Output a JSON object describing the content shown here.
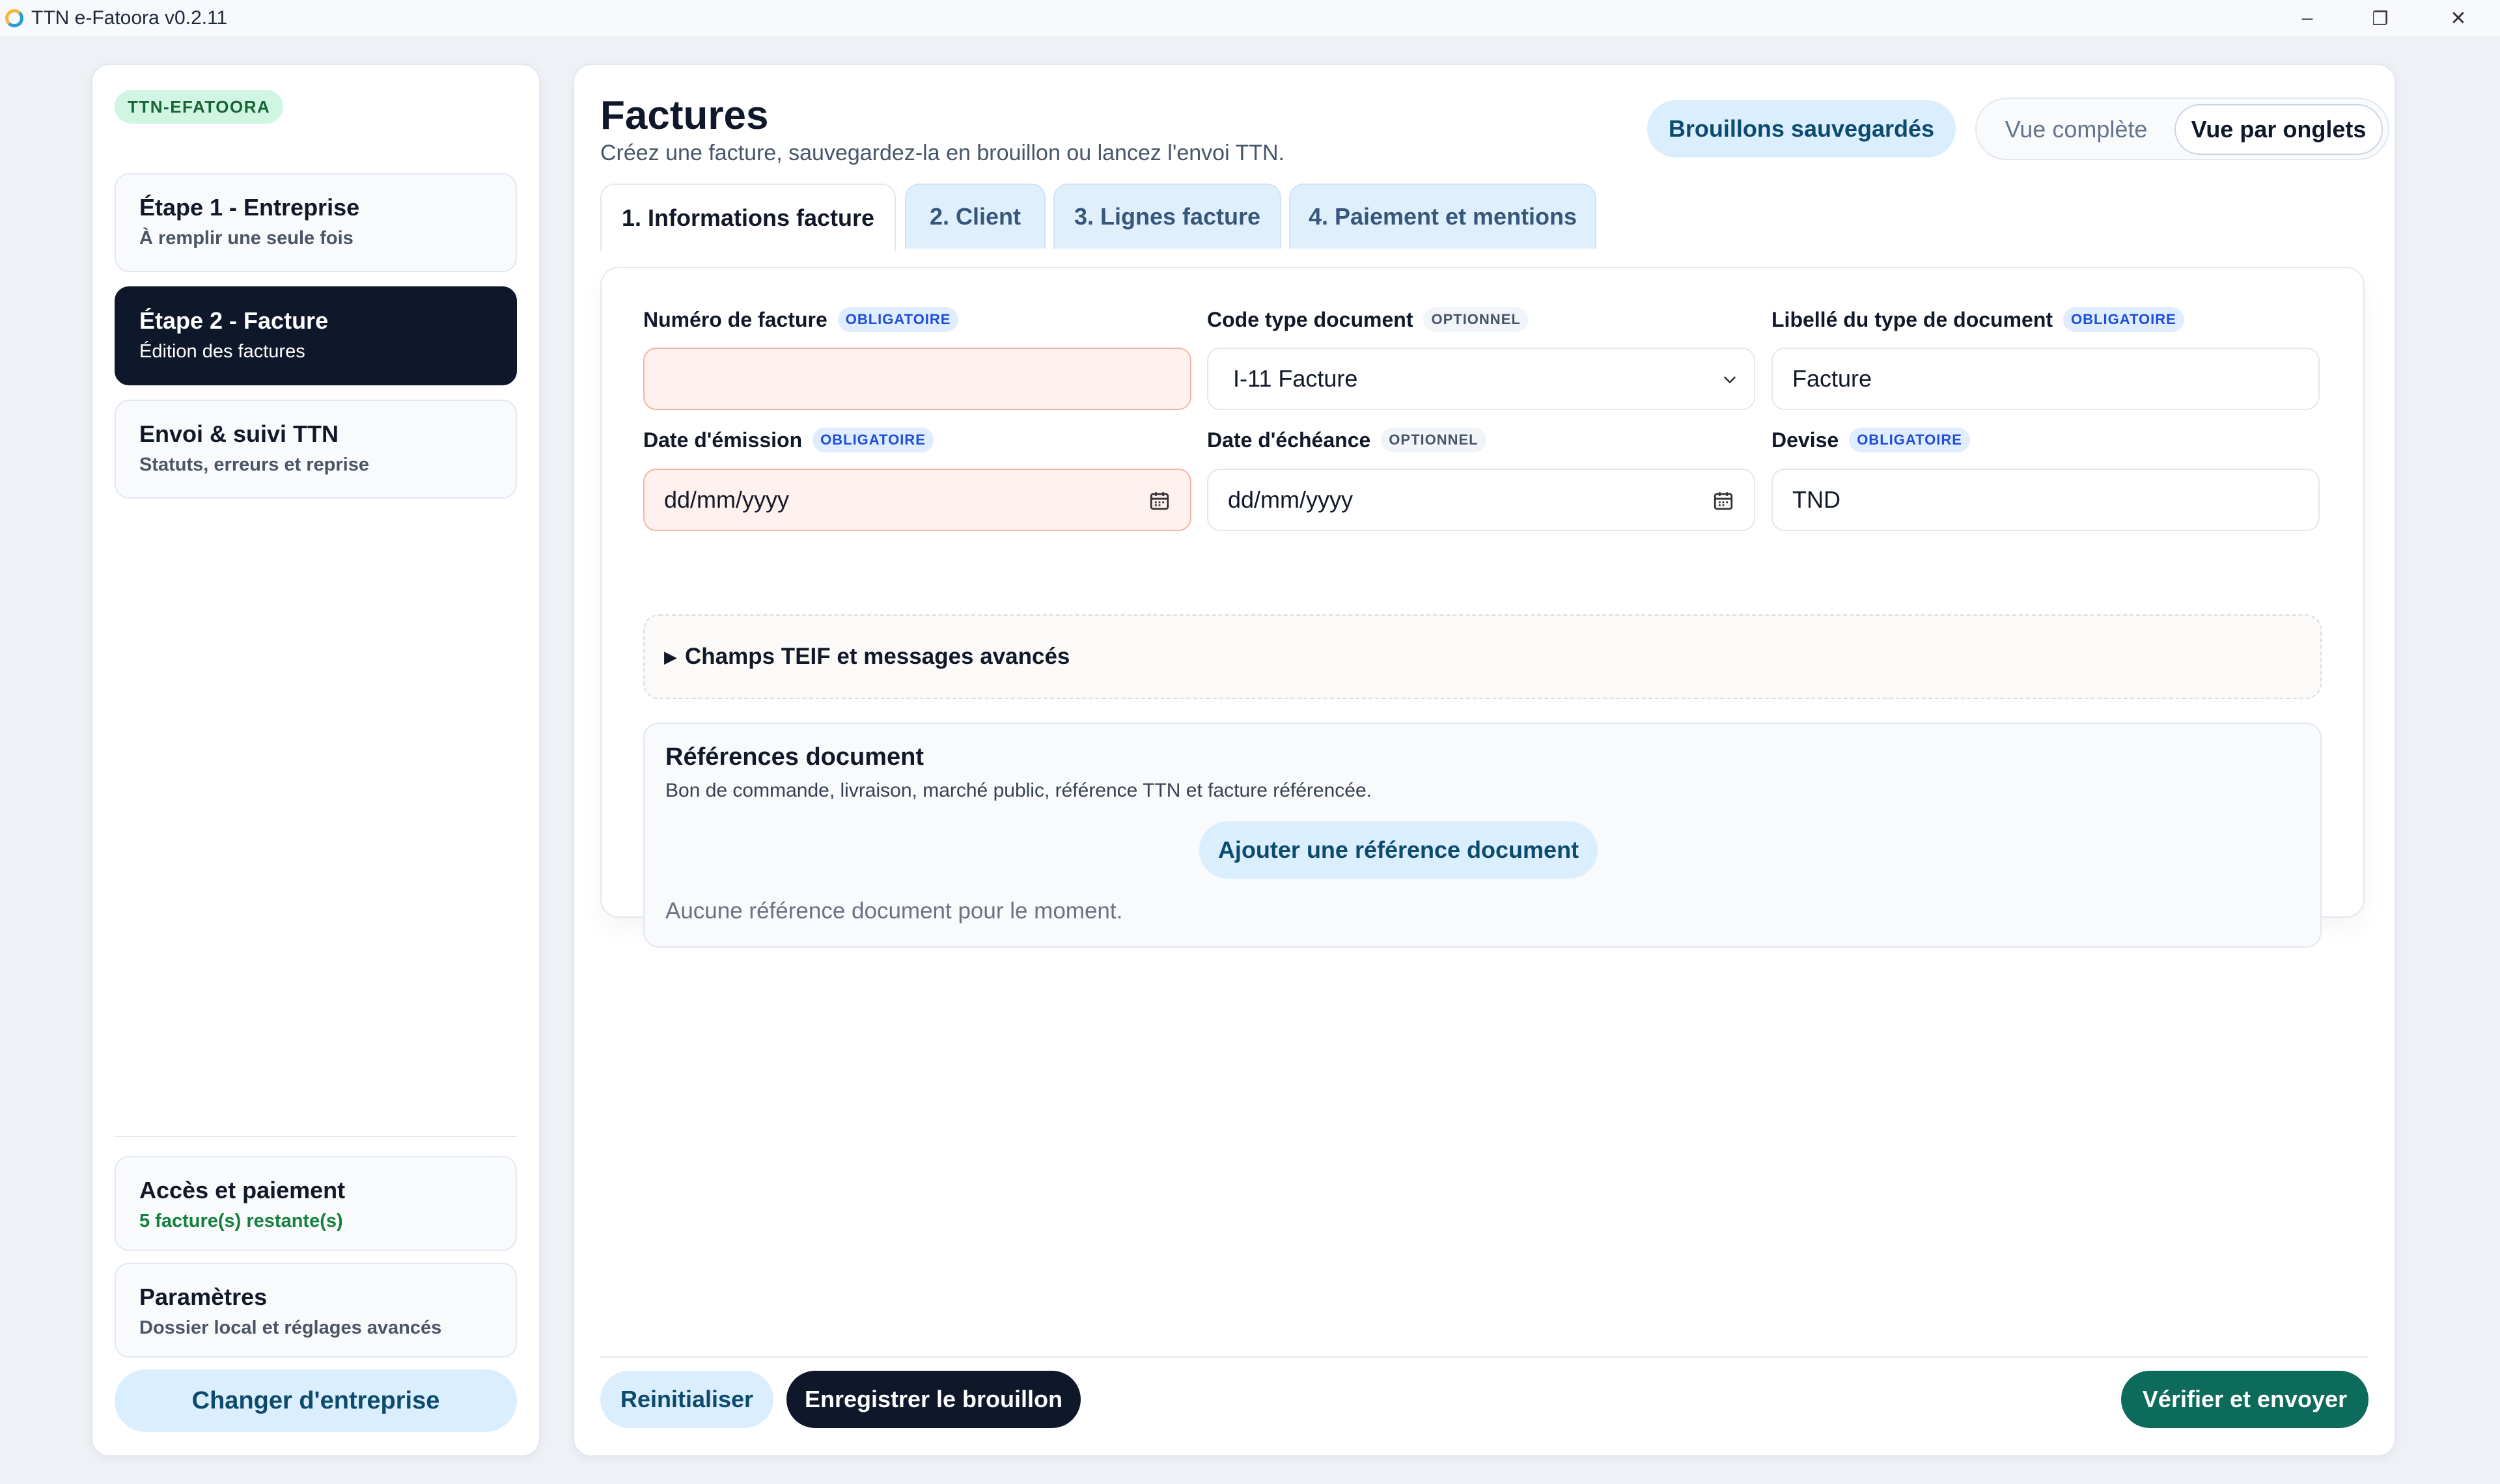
{
  "window": {
    "title": "TTN e-Fatoora v0.2.11",
    "minimize": "–",
    "maximize": "❐",
    "close": "✕"
  },
  "sidebar": {
    "badge": "TTN-EFATOORA",
    "steps": [
      {
        "title": "Étape 1 - Entreprise",
        "subtitle": "À remplir une seule fois",
        "active": false
      },
      {
        "title": "Étape 2 - Facture",
        "subtitle": "Édition des factures",
        "active": true
      },
      {
        "title": "Envoi & suivi TTN",
        "subtitle": "Statuts, erreurs et reprise",
        "active": false
      }
    ],
    "access": {
      "title": "Accès et paiement",
      "subtitle": "5 facture(s) restante(s)"
    },
    "settings": {
      "title": "Paramètres",
      "subtitle": "Dossier local et réglages avancés"
    },
    "change_company": "Changer d'entreprise"
  },
  "main": {
    "title": "Factures",
    "subtitle": "Créez une facture, sauvegardez-la en brouillon ou lancez l'envoi TTN.",
    "drafts_button": "Brouillons sauvegardés",
    "view_toggle": {
      "full": "Vue complète",
      "tabs": "Vue par onglets",
      "selected": "tabs"
    },
    "tabs": [
      {
        "label": "1. Informations facture",
        "active": true
      },
      {
        "label": "2. Client",
        "active": false
      },
      {
        "label": "3. Lignes facture",
        "active": false
      },
      {
        "label": "4. Paiement et mentions",
        "active": false
      }
    ],
    "form": {
      "invoice_number": {
        "label": "Numéro de facture",
        "badge": "OBLIGATOIRE",
        "value": ""
      },
      "doc_type_code": {
        "label": "Code type document",
        "badge": "OPTIONNEL",
        "value": "I-11 Facture"
      },
      "doc_type_label": {
        "label": "Libellé du type de document",
        "badge": "OBLIGATOIRE",
        "value": "Facture"
      },
      "issue_date": {
        "label": "Date d'émission",
        "badge": "OBLIGATOIRE",
        "placeholder": "dd/mm/yyyy"
      },
      "due_date": {
        "label": "Date d'échéance",
        "badge": "OPTIONNEL",
        "placeholder": "dd/mm/yyyy"
      },
      "currency": {
        "label": "Devise",
        "badge": "OBLIGATOIRE",
        "value": "TND"
      }
    },
    "advanced": {
      "arrow": "▶",
      "label": "Champs TEIF et messages avancés"
    },
    "references": {
      "title": "Références document",
      "subtitle": "Bon de commande, livraison, marché public, référence TTN et facture référencée.",
      "add_button": "Ajouter une référence document",
      "empty": "Aucune référence document pour le moment."
    },
    "footer": {
      "reset": "Reinitialiser",
      "save_draft": "Enregistrer le brouillon",
      "verify_send": "Vérifier et envoyer"
    }
  },
  "colors": {
    "primary_dark": "#0f172a",
    "accent_light_blue": "#dbeefe",
    "accent_teal": "#0c6b5b",
    "required_badge": "#1d4ed8",
    "error_field_bg": "#fff1ee",
    "success_green": "#15803d"
  }
}
